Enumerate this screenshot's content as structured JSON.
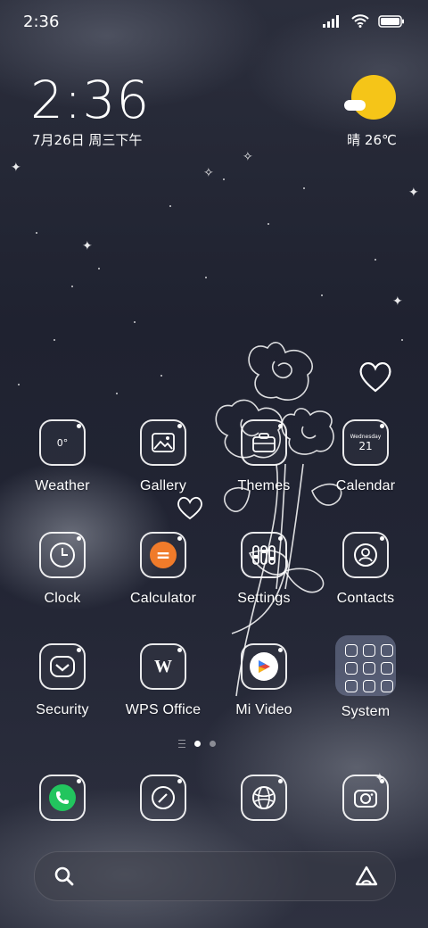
{
  "status_bar": {
    "time": "2:36"
  },
  "clock_widget": {
    "time": "2:36",
    "date": "7月26日 周三下午"
  },
  "weather_widget": {
    "condition_temp": "晴 26℃"
  },
  "apps": [
    {
      "label": "Weather",
      "icon": "weather-icon",
      "glyph": "0°"
    },
    {
      "label": "Gallery",
      "icon": "gallery-icon"
    },
    {
      "label": "Themes",
      "icon": "themes-icon"
    },
    {
      "label": "Calendar",
      "icon": "calendar-icon",
      "weekday": "Wednesday",
      "day": "21"
    },
    {
      "label": "Clock",
      "icon": "clock-icon"
    },
    {
      "label": "Calculator",
      "icon": "calculator-icon",
      "glyph": "="
    },
    {
      "label": "Settings",
      "icon": "settings-icon"
    },
    {
      "label": "Contacts",
      "icon": "contacts-icon"
    },
    {
      "label": "Security",
      "icon": "security-icon"
    },
    {
      "label": "WPS Office",
      "icon": "wps-office-icon",
      "glyph": "W"
    },
    {
      "label": "Mi Video",
      "icon": "mi-video-icon"
    },
    {
      "label": "System",
      "icon": "folder-icon"
    }
  ],
  "dock": [
    {
      "icon": "phone-icon"
    },
    {
      "icon": "notes-icon"
    },
    {
      "icon": "browser-icon"
    },
    {
      "icon": "camera-icon"
    }
  ],
  "pager": {
    "pages": 2,
    "active_index": 0
  },
  "colors": {
    "sun": "#f5c518",
    "calculator": "#f07b2a",
    "phone": "#22c55e"
  }
}
